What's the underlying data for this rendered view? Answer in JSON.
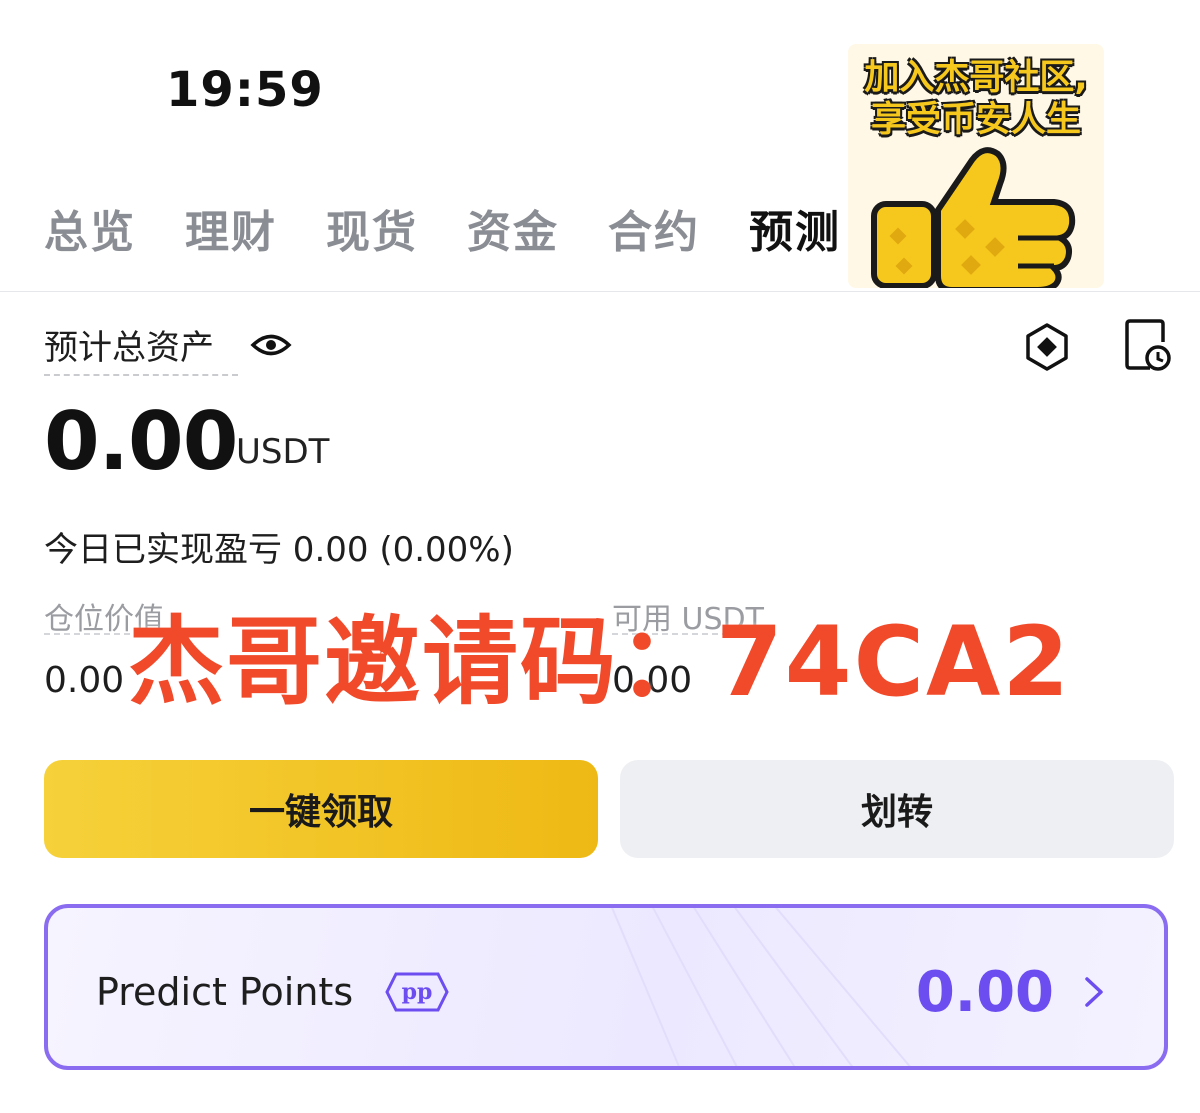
{
  "status_bar": {
    "time": "19:59"
  },
  "sticker": {
    "line1": "加入杰哥社区,",
    "line2": "享受币安人生",
    "icon": "thumbs-up-icon"
  },
  "tabs": [
    {
      "label": "总览"
    },
    {
      "label": "理财"
    },
    {
      "label": "现货"
    },
    {
      "label": "资金"
    },
    {
      "label": "合约"
    },
    {
      "label": "预测",
      "active": true
    }
  ],
  "header": {
    "asset_label": "预计总资产",
    "eye_icon": "eye-icon",
    "right_icons": [
      "hexagon-icon",
      "history-clock-icon"
    ]
  },
  "balance": {
    "value": "0.00",
    "unit": "USDT"
  },
  "pnl": {
    "text": "今日已实现盈亏 0.00 (0.00%)"
  },
  "stats": {
    "position_label": "仓位价值",
    "position_value": "0.00",
    "available_label": "可用 USDT",
    "available_value": "0.00"
  },
  "watermark": "杰哥邀请码：74CA2",
  "buttons": {
    "claim": "一键领取",
    "transfer": "划转"
  },
  "points": {
    "title": "Predict Points",
    "badge": "pp",
    "value": "0.00"
  },
  "colors": {
    "accent_yellow": "#f0c21b",
    "purple": "#6c4df0",
    "watermark_red": "#f04a2a"
  }
}
